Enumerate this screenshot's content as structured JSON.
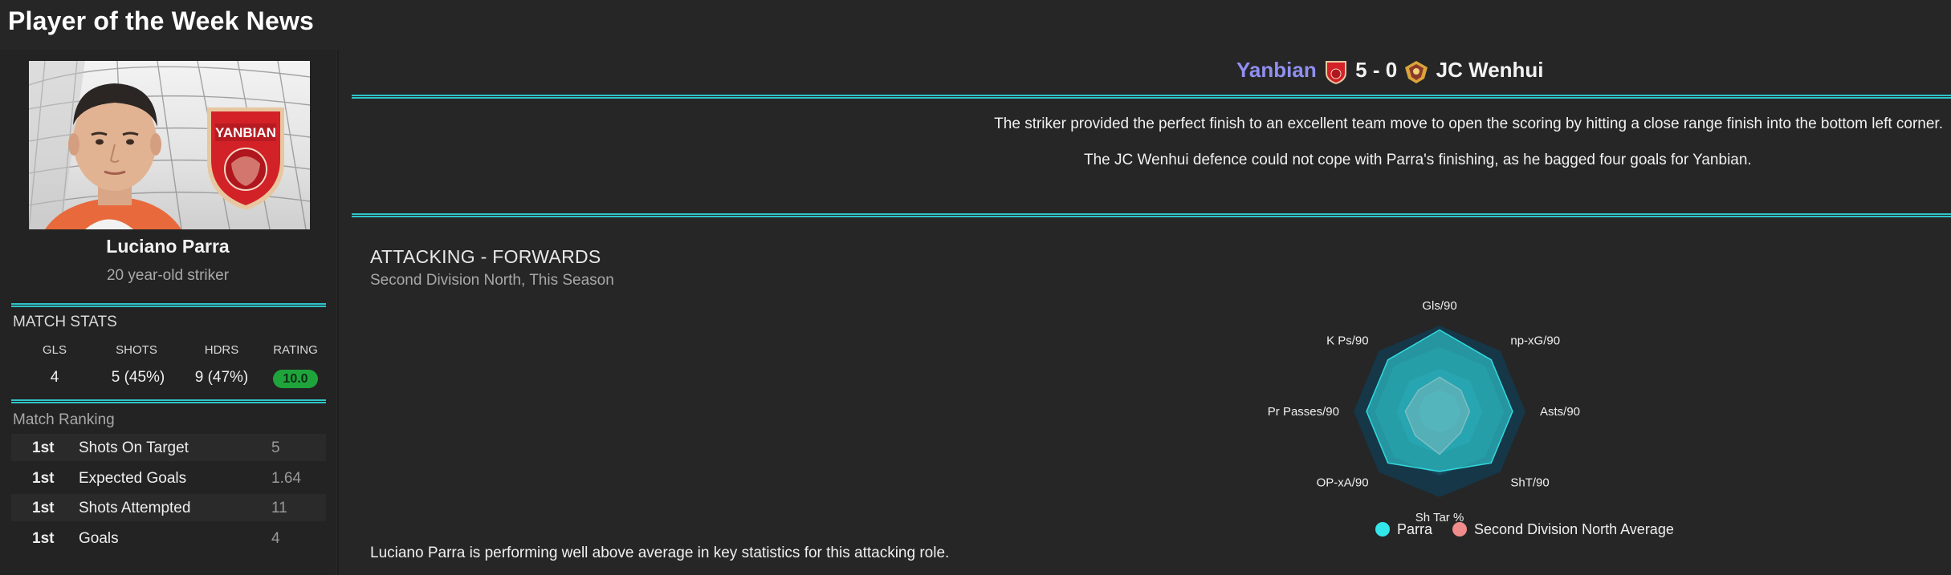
{
  "page_title": "Player of the Week News",
  "player": {
    "name": "Luciano Parra",
    "description": "20 year-old striker",
    "club_badge_text": "YANBIAN"
  },
  "match_stats": {
    "label": "MATCH STATS",
    "headers": [
      "GLS",
      "SHOTS",
      "HDRS",
      "RATING"
    ],
    "values": [
      "4",
      "5 (45%)",
      "9 (47%)",
      "10.0"
    ]
  },
  "match_ranking": {
    "label": "Match Ranking",
    "rows": [
      {
        "pos": "1st",
        "stat": "Shots On Target",
        "value": "5"
      },
      {
        "pos": "1st",
        "stat": "Expected Goals",
        "value": "1.64"
      },
      {
        "pos": "1st",
        "stat": "Shots Attempted",
        "value": "11"
      },
      {
        "pos": "1st",
        "stat": "Goals",
        "value": "4"
      }
    ]
  },
  "match": {
    "home_team": "Yanbian",
    "score": "5 - 0",
    "away_team": "JC Wenhui"
  },
  "news": [
    "The striker provided the perfect finish to an excellent team move to open the scoring by hitting a close range finish into the bottom left corner.",
    "The JC Wenhui defence could not cope with Parra's finishing, as he bagged four goals for Yanbian."
  ],
  "panel": {
    "title": "ATTACKING - FORWARDS",
    "subtitle": "Second Division North, This Season",
    "summary": "Luciano Parra is performing well above average in key statistics for this attacking role."
  },
  "chart_data": {
    "type": "radar",
    "axes": [
      "Gls/90",
      "np-xG/90",
      "Asts/90",
      "ShT/90",
      "Sh Tar %",
      "OP-xA/90",
      "Pr Passes/90",
      "K Ps/90"
    ],
    "range": [
      0,
      1
    ],
    "series": [
      {
        "name": "Parra",
        "color": "#33e6ea",
        "values": [
          0.95,
          0.85,
          0.85,
          0.85,
          0.7,
          0.85,
          0.85,
          0.85
        ]
      },
      {
        "name": "Second Division North Average",
        "color": "#f08c8c",
        "values": [
          0.4,
          0.35,
          0.35,
          0.35,
          0.5,
          0.4,
          0.4,
          0.35
        ]
      }
    ],
    "legend": [
      "Parra",
      "Second Division North Average"
    ]
  },
  "colors": {
    "accent_teal": "#2ec4c8",
    "home_team": "#8f8ff0",
    "rating_green": "#1fa43c",
    "radar_ring_dark": "#123a4a",
    "radar_ring_light": "#1b6f84"
  }
}
